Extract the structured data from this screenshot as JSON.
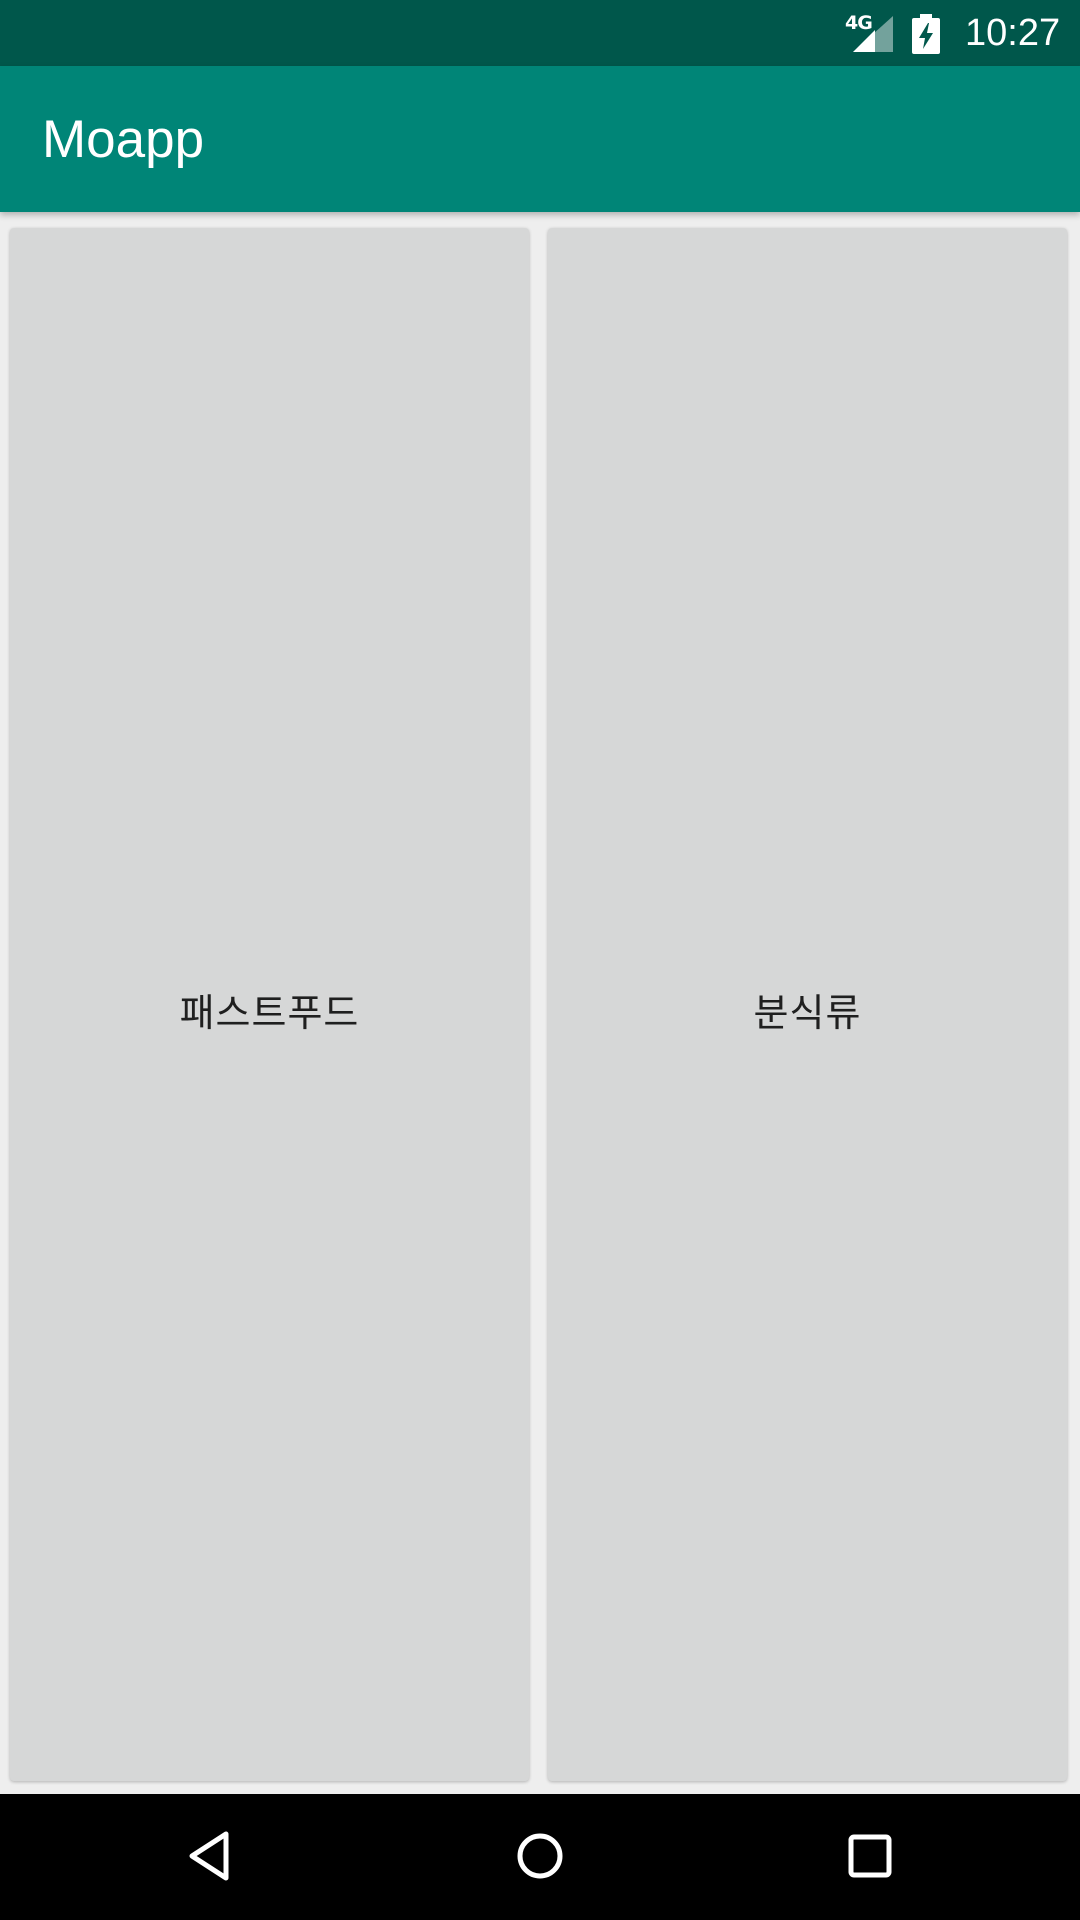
{
  "status_bar": {
    "network_label": "4G",
    "time": "10:27",
    "icons": [
      "signal-icon",
      "battery-charging-icon"
    ]
  },
  "app_bar": {
    "title": "Moapp"
  },
  "categories": [
    {
      "label": "패스트푸드"
    },
    {
      "label": "분식류"
    }
  ],
  "nav_bar": {
    "icons": [
      "back-icon",
      "home-icon",
      "recents-icon"
    ]
  },
  "colors": {
    "status_bar": "#00574b",
    "app_bar": "#008577",
    "background": "#eeeeee",
    "card": "#d6d7d7",
    "nav_bar": "#000000"
  }
}
